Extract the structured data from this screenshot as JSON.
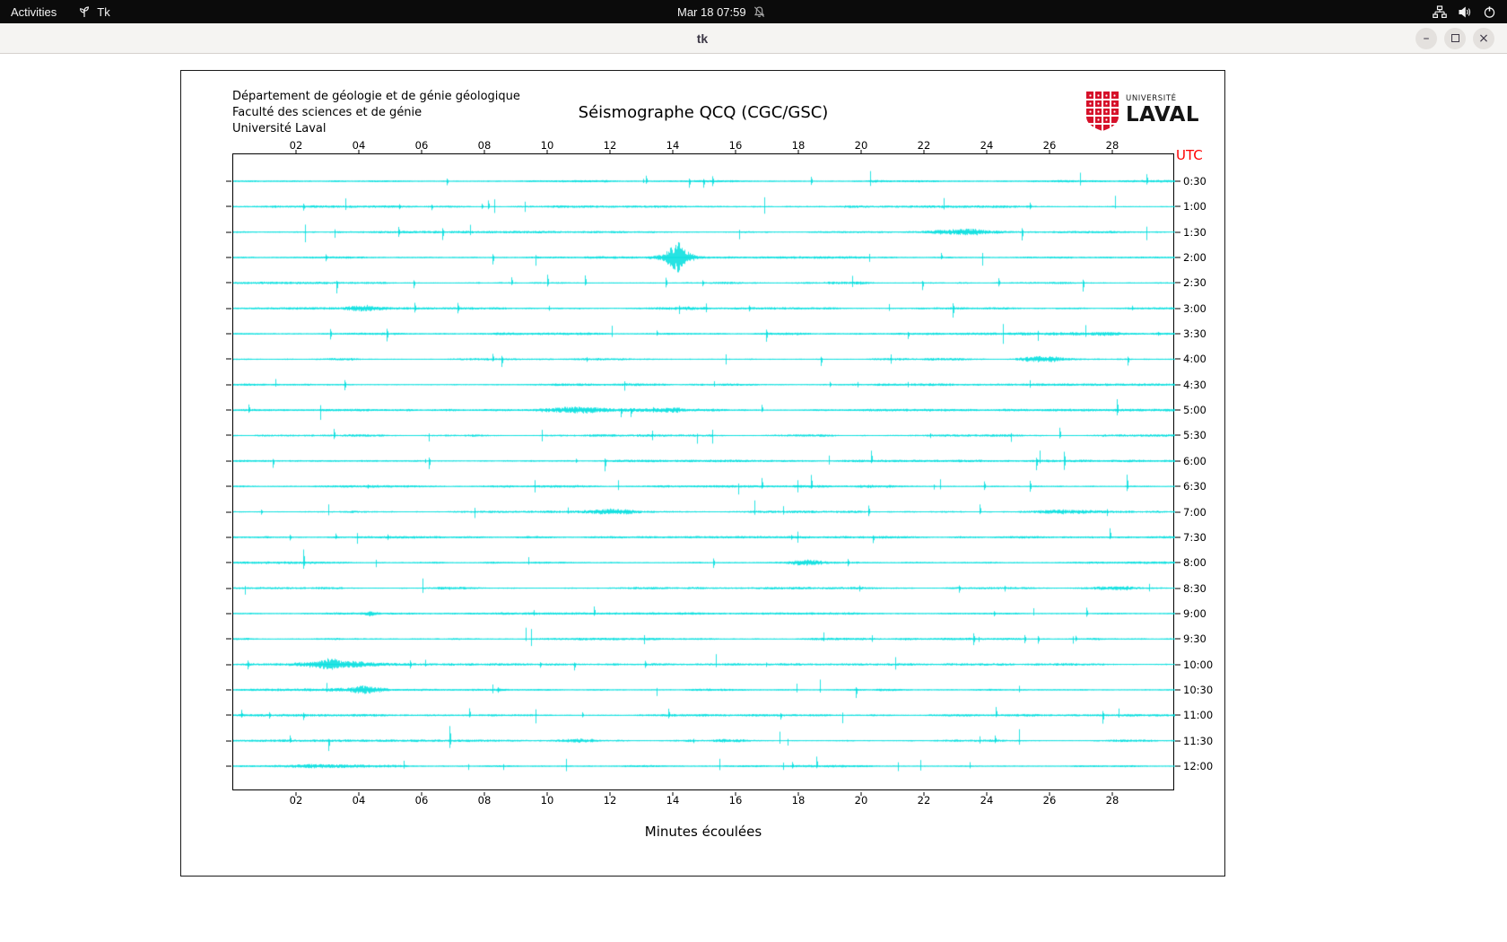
{
  "topbar": {
    "activities_label": "Activities",
    "app_indicator": "Tk",
    "clock": "Mar 18 07:59"
  },
  "window": {
    "title": "tk",
    "glyphs": {
      "minimize": "–",
      "close": "×"
    }
  },
  "app": {
    "header_lines": [
      "Département de géologie et de génie géologique",
      "Faculté des sciences et de génie",
      "Université Laval"
    ],
    "title": "Séismographe QCQ (CGC/GSC)",
    "logo": {
      "top": "UNIVERSITÉ",
      "bottom": "LAVAL",
      "color": "#d6112a"
    },
    "utc_label": "UTC",
    "utc_color": "#ff0000",
    "x_axis_label": "Minutes écoulées"
  },
  "chart_data": {
    "type": "line",
    "title": "Séismographe QCQ (CGC/GSC)",
    "xlabel": "Minutes écoulées",
    "x_ticks": [
      "02",
      "04",
      "06",
      "08",
      "10",
      "12",
      "14",
      "16",
      "18",
      "20",
      "22",
      "24",
      "26",
      "28"
    ],
    "x_range_minutes": [
      0,
      30
    ],
    "row_labels": [
      "0:30",
      "1:00",
      "1:30",
      "2:00",
      "2:30",
      "3:00",
      "3:30",
      "4:00",
      "4:30",
      "5:00",
      "5:30",
      "6:00",
      "6:30",
      "7:00",
      "7:30",
      "8:00",
      "8:30",
      "9:00",
      "9:30",
      "10:00",
      "10:30",
      "11:00",
      "11:30",
      "12:00"
    ],
    "right_axis_unit": "UTC",
    "trace_color": "#00dede",
    "grid": false,
    "legend_position": "none"
  }
}
